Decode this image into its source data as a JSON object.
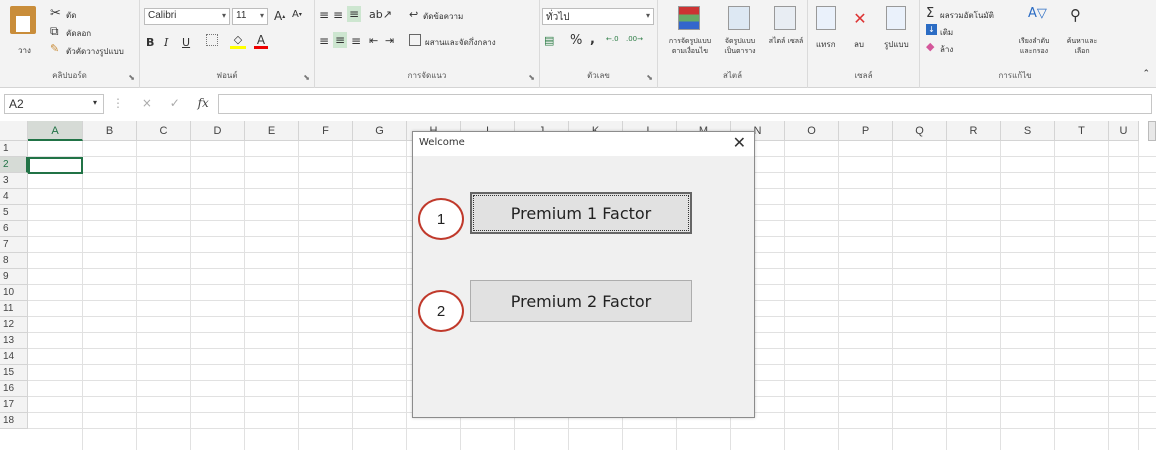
{
  "ribbon": {
    "clipboard": {
      "paste": "วาง",
      "cut": "ตัด",
      "copy": "คัดลอก",
      "format_painter": "ตัวคัดวางรูปแบบ",
      "label": "คลิปบอร์ด"
    },
    "font": {
      "name": "Calibri",
      "size": "11",
      "bold": "B",
      "italic": "I",
      "underline": "U",
      "label": "ฟอนต์"
    },
    "alignment": {
      "wrap": "ตัดข้อความ",
      "merge": "ผสานและจัดกึ่งกลาง",
      "label": "การจัดแนว"
    },
    "number": {
      "format": "ทั่วไป",
      "percent": "%",
      "comma": ",",
      "label": "ตัวเลข"
    },
    "styles": {
      "conditional": "การจัดรูปแบบ ตามเงื่อนไข",
      "table": "จัดรูปแบบ เป็นตาราง",
      "cell_styles": "สไตล์ เซลล์",
      "label": "สไตล์"
    },
    "cells": {
      "insert": "แทรก",
      "delete": "ลบ",
      "format": "รูปแบบ",
      "label": "เซลล์"
    },
    "editing": {
      "autosum": "ผลรวมอัตโนมัติ",
      "fill": "เติม",
      "clear": "ล้าง",
      "sort": "เรียงลำดับ และกรอง",
      "find": "ค้นหาและ เลือก",
      "label": "การแก้ไข"
    }
  },
  "formula_bar": {
    "name_box": "A2",
    "fx": "fx",
    "cancel": "×",
    "enter": "✓"
  },
  "grid": {
    "columns": [
      "A",
      "B",
      "C",
      "D",
      "E",
      "F",
      "G",
      "H",
      "I",
      "J",
      "K",
      "L",
      "M",
      "N",
      "O",
      "P",
      "Q",
      "R",
      "S",
      "T",
      "U"
    ],
    "rows": [
      "1",
      "2",
      "3",
      "4",
      "5",
      "6",
      "7",
      "8",
      "9",
      "10",
      "11",
      "12",
      "13",
      "14",
      "15",
      "16",
      "17",
      "18"
    ]
  },
  "dialog": {
    "title": "Welcome",
    "close": "✕",
    "button1": "Premium 1 Factor",
    "button2": "Premium 2 Factor"
  },
  "annotations": {
    "marker1": "1",
    "marker2": "2"
  },
  "colors": {
    "selection": "#217346",
    "annotation": "#c0392b",
    "ribbon_bg": "#f3f3f3"
  }
}
